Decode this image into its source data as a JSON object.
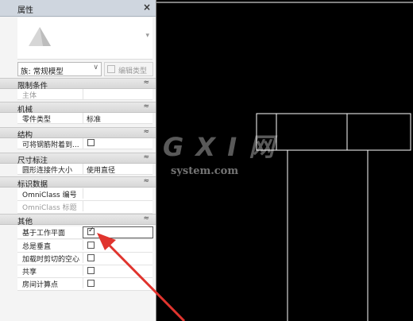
{
  "panel": {
    "title": "属性",
    "close": "×",
    "family_select": "族: 常规模型",
    "edit_type": "编辑类型"
  },
  "sections": {
    "constraints": "限制条件",
    "mechanical": "机械",
    "structure": "结构",
    "dimensions": "尺寸标注",
    "identity": "标识数据",
    "other": "其他"
  },
  "rows": {
    "host": {
      "name": "主体"
    },
    "part_type": {
      "name": "零件类型",
      "value": "标准"
    },
    "rebar": {
      "name": "可将钢筋附着到..."
    },
    "circle_size": {
      "name": "圆形连接件大小",
      "value": "使用直径"
    },
    "omni_number": {
      "name": "OmniClass 编号"
    },
    "omni_title": {
      "name": "OmniClass 标题"
    },
    "based_plane": {
      "name": "基于工作平面",
      "checked": true
    },
    "always_vertical": {
      "name": "总是垂直",
      "checked": false
    },
    "cut_void": {
      "name": "加载时剪切的空心",
      "checked": false
    },
    "shared": {
      "name": "共享",
      "checked": false
    },
    "room_calc": {
      "name": "房间计算点",
      "checked": false
    }
  },
  "watermark": {
    "logo": "G X I 网",
    "site": "system.com"
  },
  "colors": {
    "arrow": "#e0342e",
    "canvas": "#000000",
    "lines": "#ffffff"
  }
}
